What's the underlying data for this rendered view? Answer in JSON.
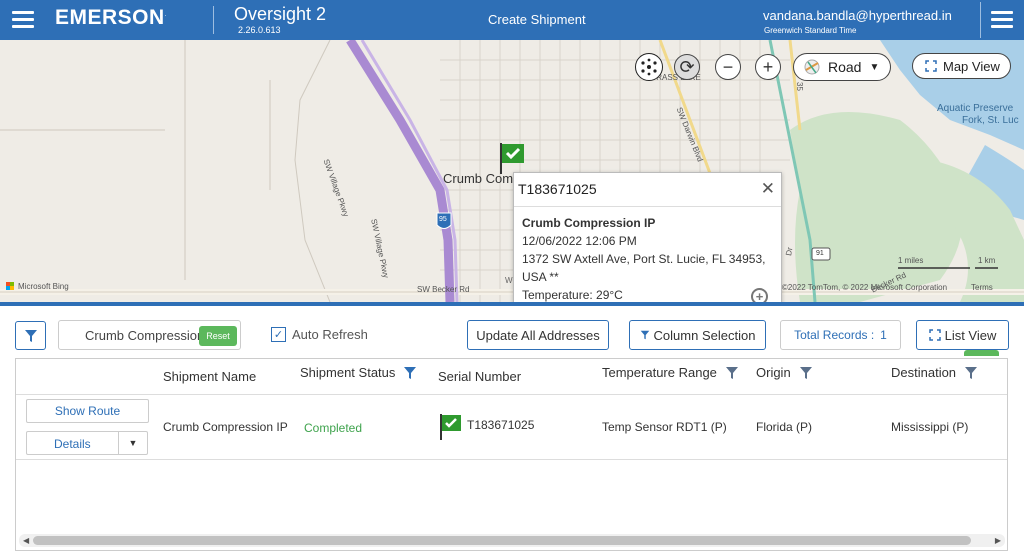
{
  "header": {
    "brand": "EMERSON",
    "brand_mark": ".",
    "app_name": "Oversight 2",
    "version": "2.26.0.613",
    "page_title": "Create Shipment",
    "user_email": "vandana.bandla@hyperthread.in",
    "timezone": "Greenwich Standard Time",
    "menu_icon": "hamburger-icon"
  },
  "map": {
    "labels": {
      "crumb": "Crumb Com",
      "woo": "WOO",
      "sw_village_1": "SW Village Pkwy",
      "sw_village_2": "SW Village Pkwy",
      "sw_becker": "SW Becker Rd",
      "becker_2": "Becker Rd",
      "darwin": "SW Darwin Blvd",
      "grass_lake": "GRASS LAKE",
      "aquatic": "Aquatic Preserve",
      "fork": "Fork, St. Luc",
      "route_95": "95",
      "route_91": "91",
      "scale_miles": "1 miles",
      "scale_km": "1 km",
      "copyright": "©2022 TomTom, © 2022 Microsoft Corporation",
      "terms": "Terms",
      "bing": "Microsoft Bing",
      "dr": "Dr",
      "num_35": "35"
    },
    "controls": {
      "road_label": "Road",
      "map_view_label": "Map View"
    },
    "popup": {
      "title": "T183671025",
      "name": "Crumb Compression IP",
      "datetime": "12/06/2022 12:06 PM",
      "address": "1372 SW Axtell Ave, Port St. Lucie, FL 34953, USA **",
      "temperature": "Temperature: 29°C"
    }
  },
  "toolbar": {
    "search_value": "Crumb Compression",
    "reset_label": "Reset",
    "auto_refresh_label": "Auto Refresh",
    "auto_refresh_checked": true,
    "update_label": "Update All Addresses",
    "column_selection_label": "Column Selection",
    "total_records_label": "Total Records :",
    "total_records_value": "1",
    "list_view_label": "List View"
  },
  "grid": {
    "columns": [
      "Shipment Name",
      "Shipment Status",
      "Serial Number",
      "Temperature Range",
      "Origin",
      "Destination"
    ],
    "rows": [
      {
        "show_route": "Show Route",
        "details": "Details",
        "shipment_name": "Crumb Compression IP",
        "status": "Completed",
        "serial": "T183671025",
        "temp_range": "Temp Sensor RDT1 (P)",
        "origin": "Florida (P)",
        "destination": "Mississippi (P)"
      }
    ]
  },
  "colors": {
    "primary": "#2e6fb6",
    "success": "#5cb85c",
    "status_completed": "#3fa34d",
    "flag": "#2f9a2f"
  }
}
